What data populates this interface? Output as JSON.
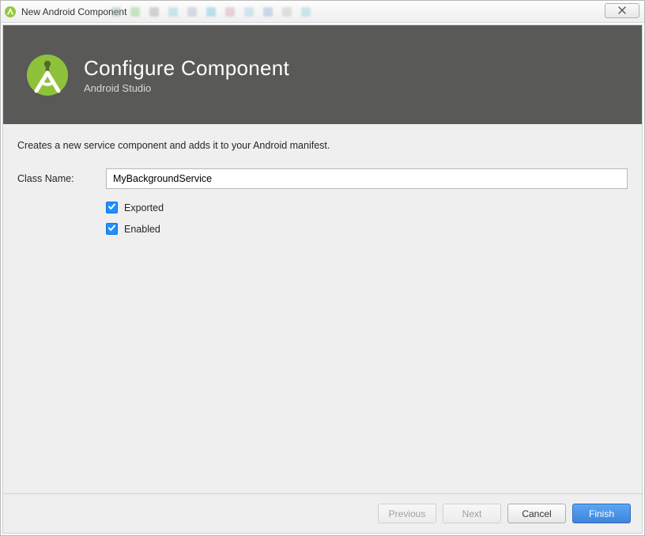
{
  "window": {
    "title": "New Android Component"
  },
  "header": {
    "title": "Configure Component",
    "subtitle": "Android Studio"
  },
  "form": {
    "description": "Creates a new service component and adds it to your Android manifest.",
    "class_name_label": "Class Name:",
    "class_name_value": "MyBackgroundService",
    "exported_label": "Exported",
    "exported_checked": true,
    "enabled_label": "Enabled",
    "enabled_checked": true
  },
  "footer": {
    "previous_label": "Previous",
    "next_label": "Next",
    "cancel_label": "Cancel",
    "finish_label": "Finish"
  },
  "colors": {
    "header_bg": "#595957",
    "accent_green": "#93c83d",
    "check_blue": "#1f8fff",
    "primary_btn": "#4a90e2"
  }
}
